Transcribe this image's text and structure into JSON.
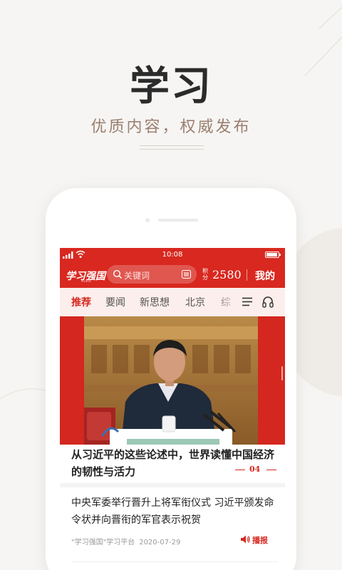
{
  "hero": {
    "title": "学习",
    "subtitle": "优质内容，权威发布"
  },
  "status_bar": {
    "time": "10:08"
  },
  "app_bar": {
    "logo_text": "学习强国",
    "logo_sub": "XUEXI",
    "search_placeholder": "关键词",
    "points_label": "积分",
    "points_value": "2580",
    "me_label": "我的"
  },
  "tabs": [
    {
      "label": "推荐",
      "active": true
    },
    {
      "label": "要闻",
      "active": false
    },
    {
      "label": "新思想",
      "active": false
    },
    {
      "label": "北京",
      "active": false
    },
    {
      "label": "综",
      "active": false
    }
  ],
  "feature": {
    "headline": "从习近平的这些论述中，世界读懂中国经济的韧性与活力",
    "page_number": "04"
  },
  "article": {
    "title": "中央军委举行晋升上将军衔仪式 习近平颁发命令状并向晋衔的军官表示祝贺",
    "source": "\"学习强国\"学习平台",
    "date": "2020-07-29",
    "broadcast_label": "播报"
  },
  "colors": {
    "brand_red": "#d8281f",
    "hero_subtitle": "#9b7f70",
    "background": "#f6f5f3"
  },
  "icons": [
    "signal-icon",
    "wifi-icon",
    "battery-icon",
    "search-icon",
    "menu-icon",
    "headphone-icon",
    "speaker-icon"
  ]
}
